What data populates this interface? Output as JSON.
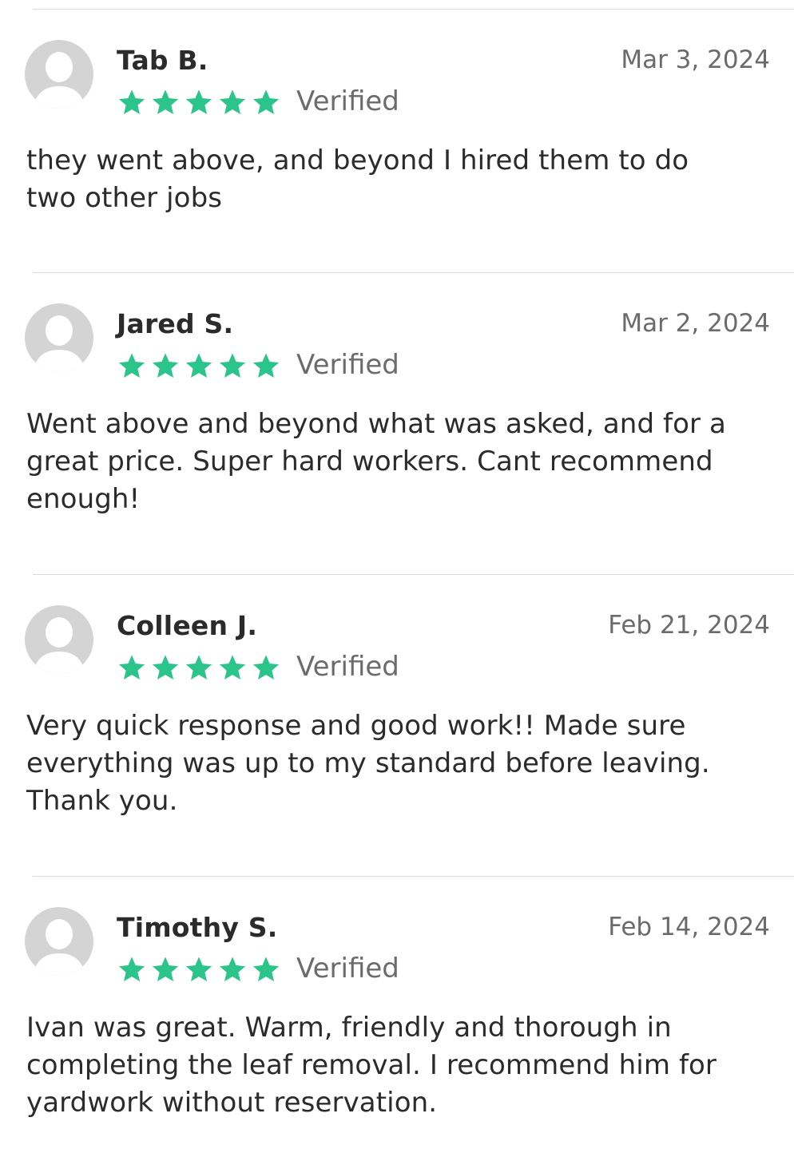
{
  "colors": {
    "star": "#2bc48a",
    "avatar": "#d4d4d4",
    "divider": "#dcdcdc"
  },
  "reviews": [
    {
      "name": "Tab B.",
      "date": "Mar 3, 2024",
      "rating": 5,
      "verified_label": "Verified",
      "text_lines": [
        "they went above, and beyond I hired them to do",
        "two other jobs"
      ]
    },
    {
      "name": "Jared S.",
      "date": "Mar 2, 2024",
      "rating": 5,
      "verified_label": "Verified",
      "text_lines": [
        "Went above and beyond what was asked, and for a",
        "great price. Super hard workers. Cant recommend",
        "enough!"
      ]
    },
    {
      "name": "Colleen J.",
      "date": "Feb 21, 2024",
      "rating": 5,
      "verified_label": "Verified",
      "text_lines": [
        "Very quick response and good work!! Made sure",
        "everything was up to my standard before leaving.",
        "Thank you."
      ]
    },
    {
      "name": "Timothy S.",
      "date": "Feb 14, 2024",
      "rating": 5,
      "verified_label": "Verified",
      "text_lines": [
        "Ivan was great.  Warm, friendly and thorough in",
        "completing the leaf removal.  I recommend him for",
        "yardwork without reservation."
      ]
    }
  ]
}
